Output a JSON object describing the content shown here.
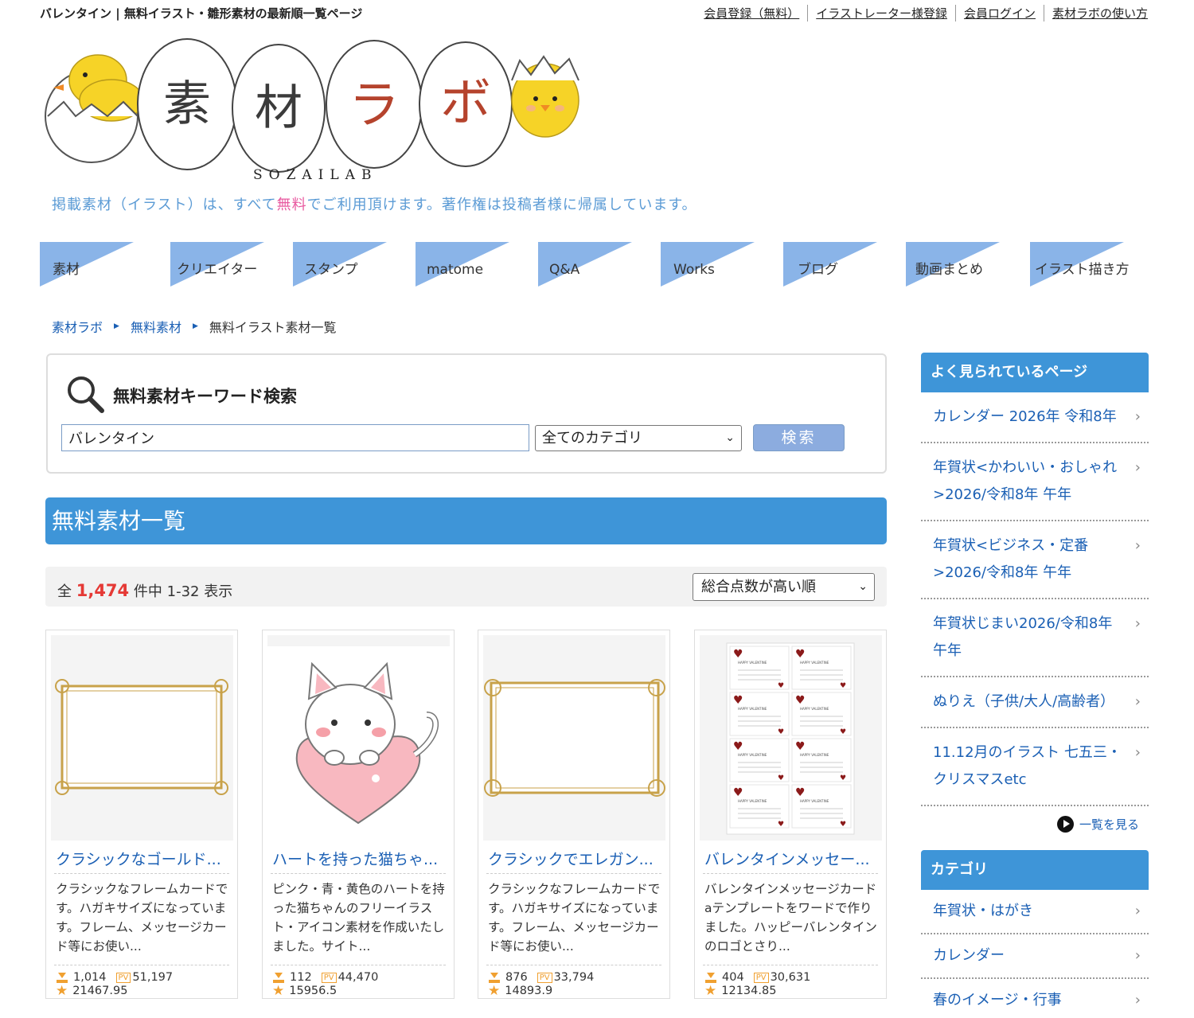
{
  "header": {
    "tagline": "バレンタイン | 無料イラスト・雛形素材の最新順一覧ページ",
    "top_links": [
      "会員登録（無料）",
      "イラストレーター様登録",
      "会員ログイン",
      "素材ラボの使い方"
    ],
    "logo_text": "素材ラボ",
    "logo_sub": "SOZAILAB",
    "notice_pre": "掲載素材（イラスト）は、すべて",
    "notice_highlight": "無料",
    "notice_post": "でご利用頂けます。著作権は投稿者様に帰属しています。"
  },
  "nav": [
    "素材",
    "クリエイター",
    "スタンプ",
    "matome",
    "Q&A",
    "Works",
    "ブログ",
    "動画まとめ",
    "イラスト描き方"
  ],
  "breadcrumb": [
    "素材ラボ",
    "無料素材",
    "無料イラスト素材一覧"
  ],
  "search": {
    "title": "無料素材キーワード検索",
    "query": "バレンタイン",
    "category": "全てのカテゴリ",
    "button": "検索"
  },
  "list": {
    "heading": "無料素材一覧",
    "count_prefix": "全",
    "count": "1,474",
    "count_suffix": "件中 1-32 表示",
    "sort": "総合点数が高い順"
  },
  "cards": [
    {
      "title": "クラシックなゴールド...",
      "desc": "クラシックなフレームカードです。ハガキサイズになっています。フレーム、メッセージカード等にお使い...",
      "downloads": "1,014",
      "pv": "51,197",
      "score": "21467.95"
    },
    {
      "title": "ハートを持った猫ちゃ...",
      "desc": "ピンク・青・黄色のハートを持った猫ちゃんのフリーイラスト・アイコン素材を作成いたしました。サイト...",
      "downloads": "112",
      "pv": "44,470",
      "score": "15956.5"
    },
    {
      "title": "クラシックでエレガン...",
      "desc": "クラシックなフレームカードです。ハガキサイズになっています。フレーム、メッセージカード等にお使い...",
      "downloads": "876",
      "pv": "33,794",
      "score": "14893.9"
    },
    {
      "title": "バレンタインメッセー...",
      "desc": "バレンタインメッセージカードaテンプレートをワードで作りました。ハッピーバレンタインのロゴとさり...",
      "downloads": "404",
      "pv": "30,631",
      "score": "12134.85"
    }
  ],
  "pv_label": "PV",
  "valentine_card_text": "HAPPY VALENTINE",
  "sidebar": {
    "popular_title": "よく見られているページ",
    "popular": [
      "カレンダー 2026年 令和8年",
      "年賀状<かわいい・おしゃれ>2026/令和8年 午年",
      "年賀状<ビジネス・定番>2026/令和8年 午年",
      "年賀状じまい2026/令和8年 午年",
      "ぬりえ（子供/大人/高齢者）",
      "11.12月のイラスト 七五三・クリスマスetc"
    ],
    "see_all": "一覧を見る",
    "category_title": "カテゴリ",
    "categories": [
      "年賀状・はがき",
      "カレンダー",
      "春のイメージ・行事"
    ]
  },
  "colors": {
    "accent_blue": "#3e95d8",
    "link_blue": "#1a5fb4",
    "nav_blue": "#8ab4e8",
    "count_red": "#e53935",
    "highlight_pink": "#e85aa0"
  }
}
